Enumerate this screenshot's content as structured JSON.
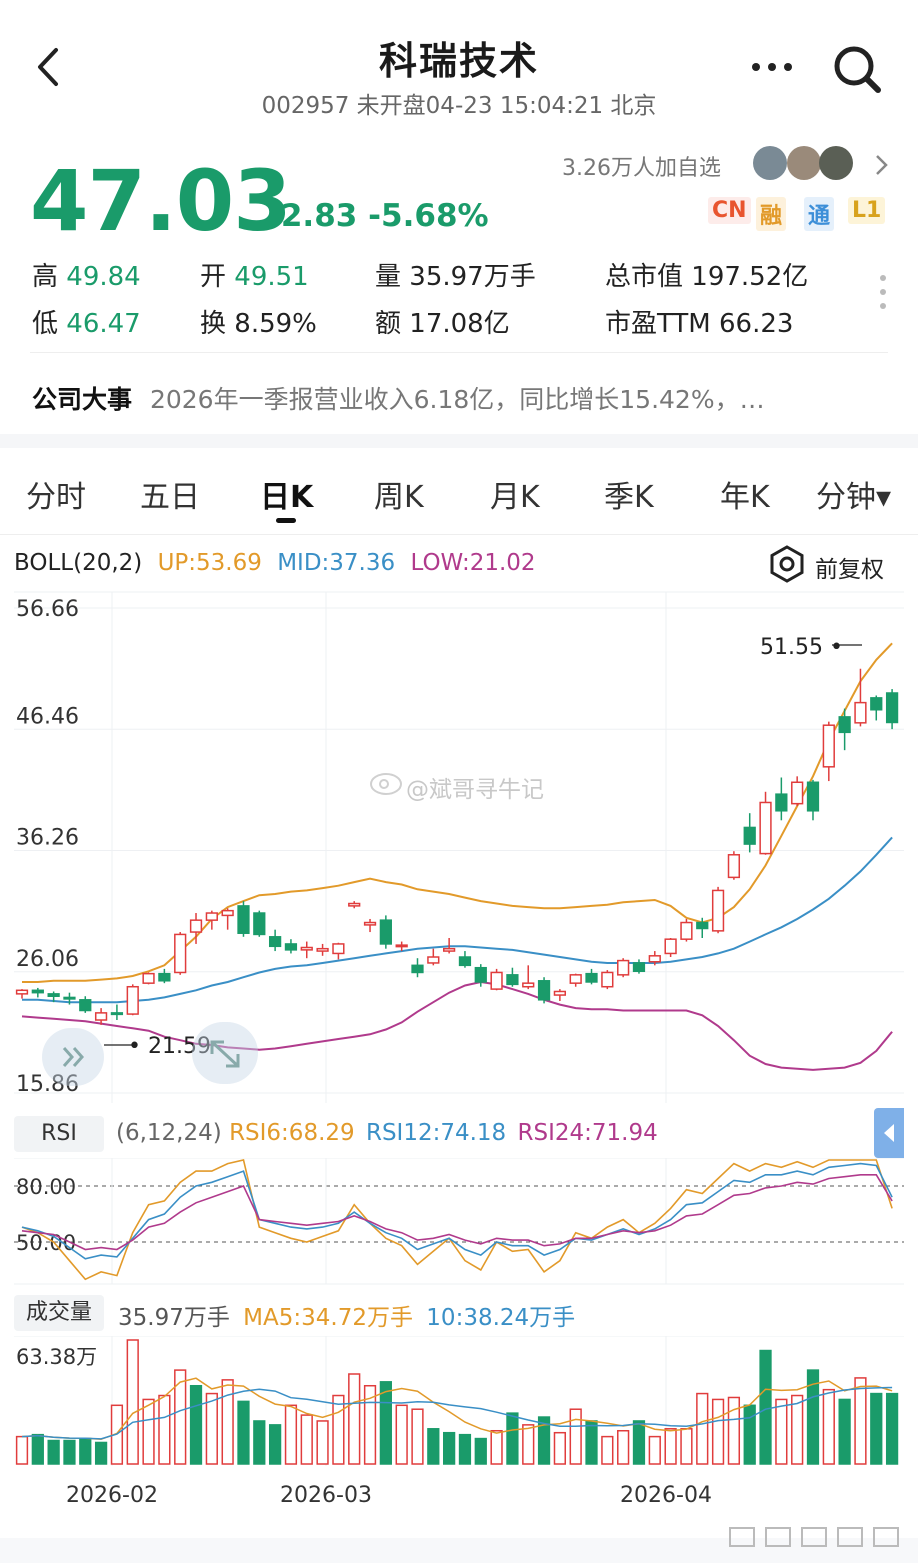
{
  "header": {
    "title": "科瑞技术",
    "subtitle": "002957 未开盘04-23 15:04:21 北京"
  },
  "quote": {
    "price": "47.03",
    "change": "-2.83",
    "change_pct": "-5.68%",
    "followers": "3.26万人加自选",
    "badges": [
      {
        "label": "CN",
        "color": "#e8552f"
      },
      {
        "label": "融",
        "color": "#e29a2a"
      },
      {
        "label": "通",
        "color": "#3d8fd8"
      },
      {
        "label": "L1",
        "color": "#d8a21c"
      }
    ],
    "stats": {
      "high_label": "高",
      "high": "49.84",
      "open_label": "开",
      "open": "49.51",
      "vol_label": "量",
      "vol": "35.97万手",
      "mcap_label": "总市值",
      "mcap": "197.52亿",
      "low_label": "低",
      "low": "46.47",
      "turn_label": "换",
      "turn": "8.59%",
      "amt_label": "额",
      "amt": "17.08亿",
      "pe_label": "市盈TTM",
      "pe": "66.23"
    }
  },
  "news": {
    "label": "公司大事",
    "text": "2026年一季报营业收入6.18亿，同比增长15.42%，…"
  },
  "tabs": [
    "分时",
    "五日",
    "日K",
    "周K",
    "月K",
    "季K",
    "年K",
    "分钟▾"
  ],
  "active_tab": 2,
  "boll": {
    "name": "BOLL(20,2)",
    "up": "UP:53.69",
    "mid": "MID:37.36",
    "low": "LOW:21.02",
    "adjust": "前复权"
  },
  "rsi": {
    "label": "RSI",
    "params": "(6,12,24)",
    "rsi6": "RSI6:68.29",
    "rsi12": "RSI12:74.18",
    "rsi24": "RSI24:71.94"
  },
  "volume": {
    "label": "成交量",
    "value": "35.97万手",
    "ma5": "MA5:34.72万手",
    "ma10": "10:38.24万手",
    "ymax": "63.38万"
  },
  "watermark": "@斌哥寻牛记",
  "colors": {
    "up": "#e03c3c",
    "down": "#1a9b6a",
    "upper": "#e29a2a",
    "mid": "#3a8fc6",
    "lower": "#b03a8c"
  },
  "chart_data": {
    "type": "candlestick",
    "y_ticks": [
      "56.66",
      "46.46",
      "36.26",
      "26.06",
      "15.86"
    ],
    "ylim": [
      15.86,
      56.66
    ],
    "x_ticks": [
      "2026-02",
      "2026-03",
      "2026-04"
    ],
    "high_annotation": "51.55",
    "low_annotation": "21.59",
    "candles": [
      [
        24.2,
        24.6,
        23.8,
        24.5
      ],
      [
        24.5,
        24.7,
        23.9,
        24.3
      ],
      [
        24.2,
        24.4,
        23.5,
        24.0
      ],
      [
        23.9,
        24.3,
        23.3,
        23.8
      ],
      [
        23.7,
        24.0,
        22.6,
        22.8
      ],
      [
        22.0,
        23.0,
        21.59,
        22.6
      ],
      [
        22.6,
        23.3,
        22.0,
        22.5
      ],
      [
        22.5,
        25.0,
        22.4,
        24.8
      ],
      [
        25.1,
        26.0,
        25.0,
        25.9
      ],
      [
        25.9,
        26.3,
        25.1,
        25.3
      ],
      [
        26.0,
        29.4,
        25.8,
        29.2
      ],
      [
        29.4,
        31.0,
        28.4,
        30.4
      ],
      [
        30.4,
        31.2,
        29.6,
        31.0
      ],
      [
        30.8,
        31.4,
        29.6,
        31.2
      ],
      [
        31.6,
        32.0,
        29.0,
        29.3
      ],
      [
        31.0,
        31.2,
        29.0,
        29.2
      ],
      [
        29.0,
        29.6,
        27.8,
        28.2
      ],
      [
        28.4,
        28.8,
        27.6,
        27.9
      ],
      [
        27.9,
        28.6,
        27.2,
        28.1
      ],
      [
        27.8,
        28.4,
        27.4,
        28.0
      ],
      [
        27.6,
        28.5,
        27.1,
        28.4
      ],
      [
        31.6,
        32.0,
        31.4,
        31.8
      ],
      [
        30.0,
        30.5,
        29.4,
        30.2
      ],
      [
        30.4,
        30.8,
        28.0,
        28.4
      ],
      [
        28.2,
        28.6,
        27.8,
        28.3
      ],
      [
        26.6,
        27.2,
        25.6,
        26.0
      ],
      [
        26.8,
        28.0,
        26.6,
        27.3
      ],
      [
        27.8,
        28.9,
        27.6,
        28.0
      ],
      [
        27.3,
        27.8,
        26.4,
        26.6
      ],
      [
        26.4,
        26.7,
        24.8,
        25.2
      ],
      [
        24.6,
        26.3,
        24.5,
        26.0
      ],
      [
        25.8,
        26.4,
        24.8,
        25.0
      ],
      [
        24.8,
        26.6,
        24.6,
        25.1
      ],
      [
        25.3,
        25.6,
        23.4,
        23.7
      ],
      [
        24.1,
        24.6,
        23.6,
        24.4
      ],
      [
        25.1,
        25.9,
        24.8,
        25.8
      ],
      [
        25.9,
        26.3,
        25.0,
        25.2
      ],
      [
        24.8,
        26.2,
        24.6,
        26.0
      ],
      [
        25.8,
        27.2,
        25.6,
        27.0
      ],
      [
        26.8,
        27.1,
        25.9,
        26.1
      ],
      [
        26.9,
        27.8,
        26.6,
        27.4
      ],
      [
        27.6,
        28.9,
        27.3,
        28.8
      ],
      [
        28.8,
        30.5,
        28.6,
        30.2
      ],
      [
        30.2,
        30.6,
        28.9,
        29.7
      ],
      [
        29.5,
        33.2,
        29.3,
        32.9
      ],
      [
        34.0,
        36.2,
        33.8,
        35.9
      ],
      [
        38.2,
        39.4,
        36.1,
        36.8
      ],
      [
        36.0,
        41.2,
        35.9,
        40.3
      ],
      [
        41.0,
        42.4,
        38.8,
        39.6
      ],
      [
        40.2,
        42.5,
        40.0,
        42.0
      ],
      [
        42.0,
        42.2,
        38.8,
        39.6
      ],
      [
        43.3,
        47.1,
        42.1,
        46.8
      ],
      [
        47.5,
        48.2,
        44.7,
        46.2
      ],
      [
        47.0,
        51.55,
        46.7,
        48.7
      ],
      [
        49.1,
        49.3,
        47.2,
        48.1
      ],
      [
        49.51,
        49.84,
        46.47,
        47.03
      ]
    ],
    "series": [
      {
        "name": "UP",
        "values": [
          25.2,
          25.2,
          25.3,
          25.3,
          25.3,
          25.4,
          25.5,
          25.7,
          26.1,
          26.6,
          27.8,
          29.0,
          30.5,
          31.5,
          32.0,
          32.5,
          32.6,
          32.8,
          32.9,
          33.1,
          33.3,
          33.6,
          33.9,
          33.6,
          33.4,
          33.0,
          32.8,
          32.6,
          32.3,
          32.0,
          31.8,
          31.6,
          31.5,
          31.4,
          31.4,
          31.5,
          31.6,
          31.7,
          31.9,
          32.0,
          32.1,
          31.6,
          30.6,
          30.2,
          30.6,
          31.5,
          33.0,
          35.0,
          37.5,
          40.0,
          42.5,
          45.5,
          48.0,
          50.5,
          52.3,
          53.69
        ]
      },
      {
        "name": "MID",
        "values": [
          23.7,
          23.7,
          23.6,
          23.5,
          23.5,
          23.5,
          23.5,
          23.6,
          23.7,
          23.9,
          24.2,
          24.5,
          24.9,
          25.2,
          25.6,
          26.0,
          26.3,
          26.5,
          26.6,
          26.8,
          27.0,
          27.2,
          27.4,
          27.6,
          27.8,
          28.0,
          28.1,
          28.2,
          28.2,
          28.1,
          28.0,
          27.9,
          27.7,
          27.5,
          27.3,
          27.1,
          26.9,
          26.8,
          26.8,
          26.8,
          26.8,
          26.9,
          27.1,
          27.3,
          27.6,
          28.0,
          28.6,
          29.2,
          29.8,
          30.5,
          31.3,
          32.2,
          33.3,
          34.5,
          35.9,
          37.36
        ]
      },
      {
        "name": "LOW",
        "values": [
          22.3,
          22.2,
          22.1,
          22.0,
          21.9,
          21.7,
          21.5,
          21.3,
          21.1,
          20.6,
          20.3,
          20.0,
          19.9,
          19.7,
          19.6,
          19.5,
          19.6,
          19.8,
          20.0,
          20.2,
          20.4,
          20.6,
          20.8,
          21.2,
          21.8,
          22.7,
          23.5,
          24.3,
          24.9,
          25.2,
          25.0,
          24.6,
          24.2,
          23.7,
          23.3,
          23.0,
          22.9,
          22.9,
          22.8,
          22.8,
          22.8,
          22.8,
          22.8,
          22.4,
          21.5,
          20.3,
          19.0,
          18.3,
          18.0,
          17.9,
          17.8,
          17.9,
          18.0,
          18.4,
          19.4,
          21.02
        ]
      },
      {
        "name": "RSI6",
        "values": [
          58,
          55,
          50,
          40,
          30,
          34,
          32,
          55,
          70,
          72,
          82,
          88,
          88,
          92,
          96,
          58,
          55,
          52,
          50,
          53,
          56,
          70,
          60,
          52,
          48,
          38,
          45,
          52,
          40,
          35,
          50,
          45,
          46,
          34,
          40,
          55,
          52,
          58,
          62,
          55,
          60,
          68,
          78,
          76,
          84,
          92,
          88,
          92,
          90,
          93,
          90,
          96,
          96,
          98,
          96,
          68
        ]
      },
      {
        "name": "RSI12",
        "values": [
          58,
          56,
          53,
          47,
          41,
          43,
          42,
          52,
          62,
          65,
          74,
          80,
          82,
          85,
          88,
          62,
          60,
          58,
          57,
          58,
          60,
          66,
          60,
          55,
          52,
          46,
          49,
          52,
          46,
          43,
          50,
          48,
          48,
          43,
          46,
          52,
          51,
          54,
          57,
          54,
          57,
          62,
          70,
          71,
          77,
          83,
          82,
          86,
          86,
          88,
          86,
          90,
          91,
          92,
          91,
          74
        ]
      },
      {
        "name": "RSI24",
        "values": [
          56,
          55,
          54,
          50,
          46,
          47,
          46,
          51,
          58,
          60,
          66,
          71,
          74,
          77,
          80,
          62,
          61,
          60,
          59,
          60,
          61,
          64,
          61,
          57,
          55,
          51,
          52,
          54,
          51,
          49,
          52,
          51,
          51,
          48,
          49,
          52,
          52,
          54,
          56,
          55,
          56,
          59,
          64,
          65,
          70,
          75,
          76,
          79,
          80,
          82,
          81,
          84,
          85,
          86,
          86,
          71.94
        ]
      }
    ],
    "rsi_ticks": [
      "80.00",
      "50.00"
    ],
    "volume": [
      14,
      15,
      12,
      12,
      13,
      11,
      30,
      63.38,
      33,
      35,
      48,
      40,
      36,
      43,
      32,
      22,
      20,
      30,
      25,
      22,
      35,
      46,
      40,
      42,
      30,
      28,
      18,
      16,
      15,
      13,
      17,
      26,
      20,
      24,
      16,
      28,
      22,
      14,
      17,
      22,
      14,
      18,
      18,
      36,
      33,
      34,
      30,
      58,
      33,
      35,
      48,
      38,
      33,
      44,
      36,
      35.97
    ],
    "vol_up": [
      1,
      0,
      0,
      0,
      0,
      0,
      1,
      1,
      1,
      1,
      1,
      0,
      1,
      1,
      0,
      0,
      0,
      1,
      1,
      1,
      1,
      1,
      1,
      0,
      1,
      1,
      0,
      0,
      0,
      0,
      1,
      0,
      1,
      0,
      1,
      1,
      0,
      1,
      1,
      0,
      1,
      1,
      1,
      1,
      1,
      1,
      0,
      0,
      1,
      1,
      0,
      1,
      0,
      1,
      0,
      0
    ]
  }
}
